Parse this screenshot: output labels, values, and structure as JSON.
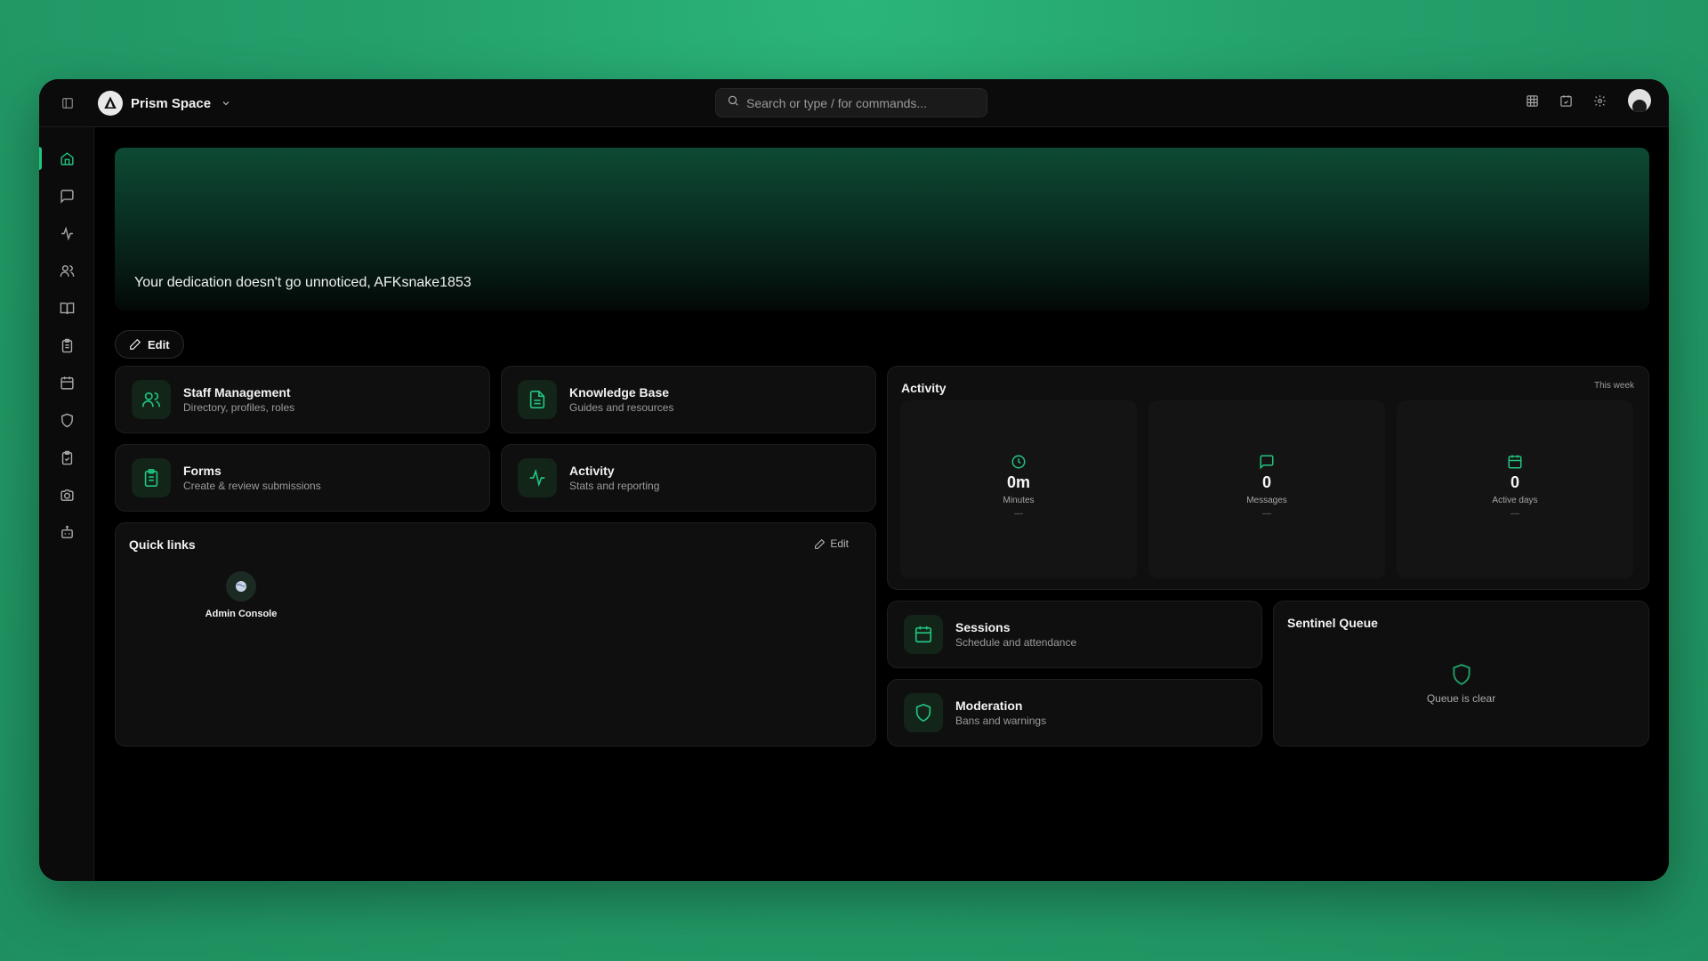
{
  "app": {
    "workspace_name": "Prism Space",
    "search_placeholder": "Search or type / for commands..."
  },
  "topbar": {
    "icons": [
      "grid-icon",
      "calendar-check-icon",
      "gear-icon",
      "user-avatar"
    ]
  },
  "sidebar": {
    "items": [
      {
        "icon": "home-icon",
        "active": true
      },
      {
        "icon": "message-icon",
        "active": false
      },
      {
        "icon": "activity-icon",
        "active": false
      },
      {
        "icon": "users-icon",
        "active": false
      },
      {
        "icon": "book-icon",
        "active": false
      },
      {
        "icon": "clipboard-icon",
        "active": false
      },
      {
        "icon": "calendar-icon",
        "active": false
      },
      {
        "icon": "shield-icon",
        "active": false
      },
      {
        "icon": "clipboard-check-icon",
        "active": false
      },
      {
        "icon": "camera-icon",
        "active": false
      },
      {
        "icon": "bot-icon",
        "active": false
      }
    ]
  },
  "hero": {
    "message": "Your dedication doesn't go unnoticed, AFKsnake1853"
  },
  "edit_button": {
    "label": "Edit"
  },
  "tiles": {
    "staff": {
      "title": "Staff Management",
      "subtitle": "Directory, profiles, roles"
    },
    "knowledge": {
      "title": "Knowledge Base",
      "subtitle": "Guides and resources"
    },
    "forms": {
      "title": "Forms",
      "subtitle": "Create & review submissions"
    },
    "activity": {
      "title": "Activity",
      "subtitle": "Stats and reporting"
    },
    "sessions": {
      "title": "Sessions",
      "subtitle": "Schedule and attendance"
    },
    "moderation": {
      "title": "Moderation",
      "subtitle": "Bans and warnings"
    }
  },
  "quick_links": {
    "title": "Quick links",
    "edit_label": "Edit",
    "items": [
      {
        "label": "Admin Console"
      }
    ]
  },
  "activity_panel": {
    "title": "Activity",
    "period": "This week",
    "stats": [
      {
        "value": "0m",
        "label": "Minutes",
        "sub": "—"
      },
      {
        "value": "0",
        "label": "Messages",
        "sub": "—"
      },
      {
        "value": "0",
        "label": "Active days",
        "sub": "—"
      }
    ]
  },
  "sentinel_queue": {
    "title": "Sentinel Queue",
    "empty_text": "Queue is clear"
  },
  "colors": {
    "accent": "#22c47e",
    "background_outer": "#24a06b",
    "panel": "#0f0f0f"
  }
}
